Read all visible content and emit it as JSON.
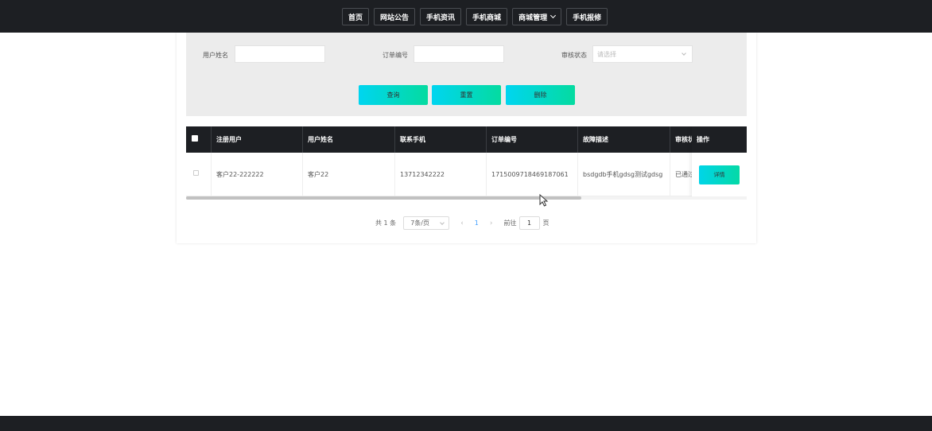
{
  "nav": {
    "items": [
      "首页",
      "网站公告",
      "手机资讯",
      "手机商城",
      "商城管理",
      "手机报修"
    ]
  },
  "filter": {
    "username_label": "用户姓名",
    "username_value": "",
    "order_label": "订单编号",
    "order_value": "",
    "status_label": "审核状态",
    "status_placeholder": "请选择",
    "buttons": {
      "search": "查询",
      "reset": "重置",
      "delete": "删除"
    }
  },
  "table": {
    "headers": [
      "注册用户",
      "用户姓名",
      "联系手机",
      "订单编号",
      "故障描述",
      "审核状",
      "操作"
    ],
    "rows": [
      {
        "reg_user": "客户22-222222",
        "name": "客户22",
        "phone": "13712342222",
        "order_no": "1715009718469187061",
        "fault": "bsdgdb手机gdsg测试gdsg",
        "status": "已通过",
        "action": "详情"
      }
    ]
  },
  "pagination": {
    "total": "共 1 条",
    "page_size": "7条/页",
    "current_page": "1",
    "goto_label": "前往",
    "goto_value": "1",
    "page_unit": "页"
  },
  "colors": {
    "header_bg": "#1d1f23",
    "accent_gradient_start": "#00d5f0",
    "accent_gradient_end": "#04dba0",
    "page_link": "#409eff"
  }
}
